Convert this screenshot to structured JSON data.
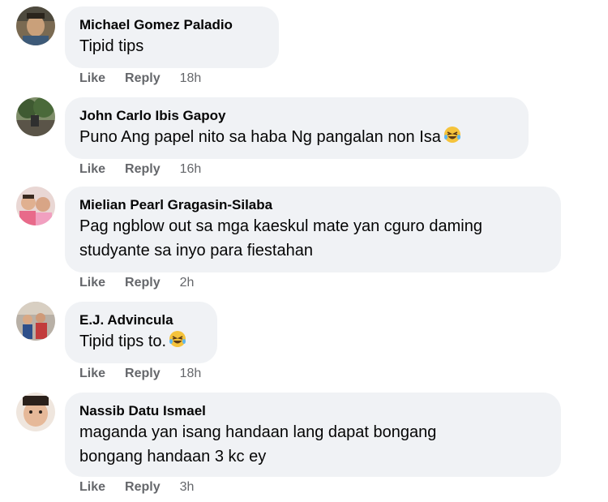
{
  "comments": [
    {
      "author": "Michael Gomez Paladio",
      "lines": [
        "Tipid tips"
      ],
      "like": "Like",
      "reply": "Reply",
      "time": "18h",
      "has_emoji": false
    },
    {
      "author": "John Carlo Ibis Gapoy",
      "lines": [
        "Puno Ang papel nito sa haba Ng pangalan non Isa"
      ],
      "like": "Like",
      "reply": "Reply",
      "time": "16h",
      "has_emoji": true,
      "emoji": "rolling-on-floor-laughing"
    },
    {
      "author": "Mielian Pearl Gragasin-Silaba",
      "lines": [
        "Pag ngblow out sa mga kaeskul mate yan cguro daming",
        "studyante sa inyo para fiestahan"
      ],
      "like": "Like",
      "reply": "Reply",
      "time": "2h",
      "has_emoji": false
    },
    {
      "author": "E.J. Advincula",
      "lines": [
        "Tipid tips to."
      ],
      "like": "Like",
      "reply": "Reply",
      "time": "18h",
      "has_emoji": true,
      "emoji": "rolling-on-floor-laughing"
    },
    {
      "author": "Nassib Datu Ismael",
      "lines": [
        "maganda yan isang handaan lang dapat bongang",
        "bongang handaan 3 kc ey"
      ],
      "like": "Like",
      "reply": "Reply",
      "time": "3h",
      "has_emoji": false
    }
  ],
  "colors": {
    "bubble": "#f0f2f5",
    "meta_text": "#65676b",
    "text": "#050505"
  }
}
